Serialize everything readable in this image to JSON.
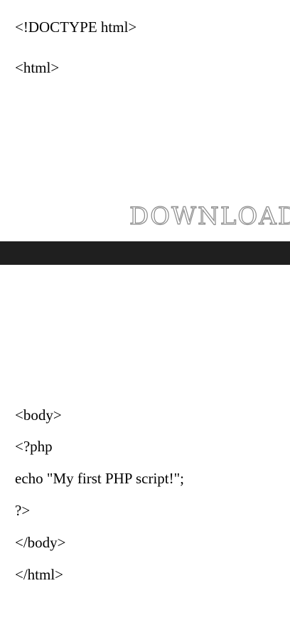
{
  "code_top": [
    "<!DOCTYPE html>",
    "<html>"
  ],
  "banner": {
    "text": "DOWNLOAD"
  },
  "code_bottom": [
    "<body>",
    "<?php",
    "echo \"My first PHP script!\";",
    "?>",
    "</body>",
    "</html>"
  ],
  "colors": {
    "bar": "#1f1f1f",
    "banner_outline": "#8a8a8a"
  }
}
